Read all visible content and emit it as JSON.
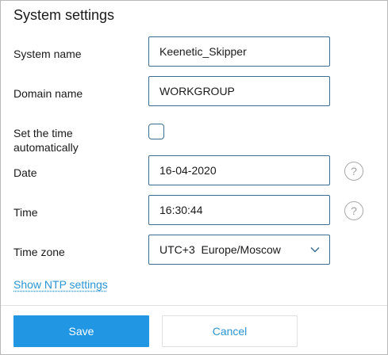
{
  "dialog": {
    "title": "System settings"
  },
  "fields": {
    "system_name": {
      "label": "System name",
      "value": "Keenetic_Skipper"
    },
    "domain_name": {
      "label": "Domain name",
      "value": "WORKGROUP"
    },
    "auto_time": {
      "label_line1": "Set the time",
      "label_line2": "automatically",
      "checked": false
    },
    "date": {
      "label": "Date",
      "value": "16-04-2020",
      "help": "?"
    },
    "time": {
      "label": "Time",
      "value": "16:30:44",
      "help": "?"
    },
    "time_zone": {
      "label": "Time zone",
      "value": "UTC+3  Europe/Moscow"
    }
  },
  "links": {
    "ntp": "Show NTP settings"
  },
  "buttons": {
    "save": "Save",
    "cancel": "Cancel"
  },
  "colors": {
    "accent": "#2196e3",
    "link": "#2a95d3",
    "input_border": "#3b6e91"
  }
}
